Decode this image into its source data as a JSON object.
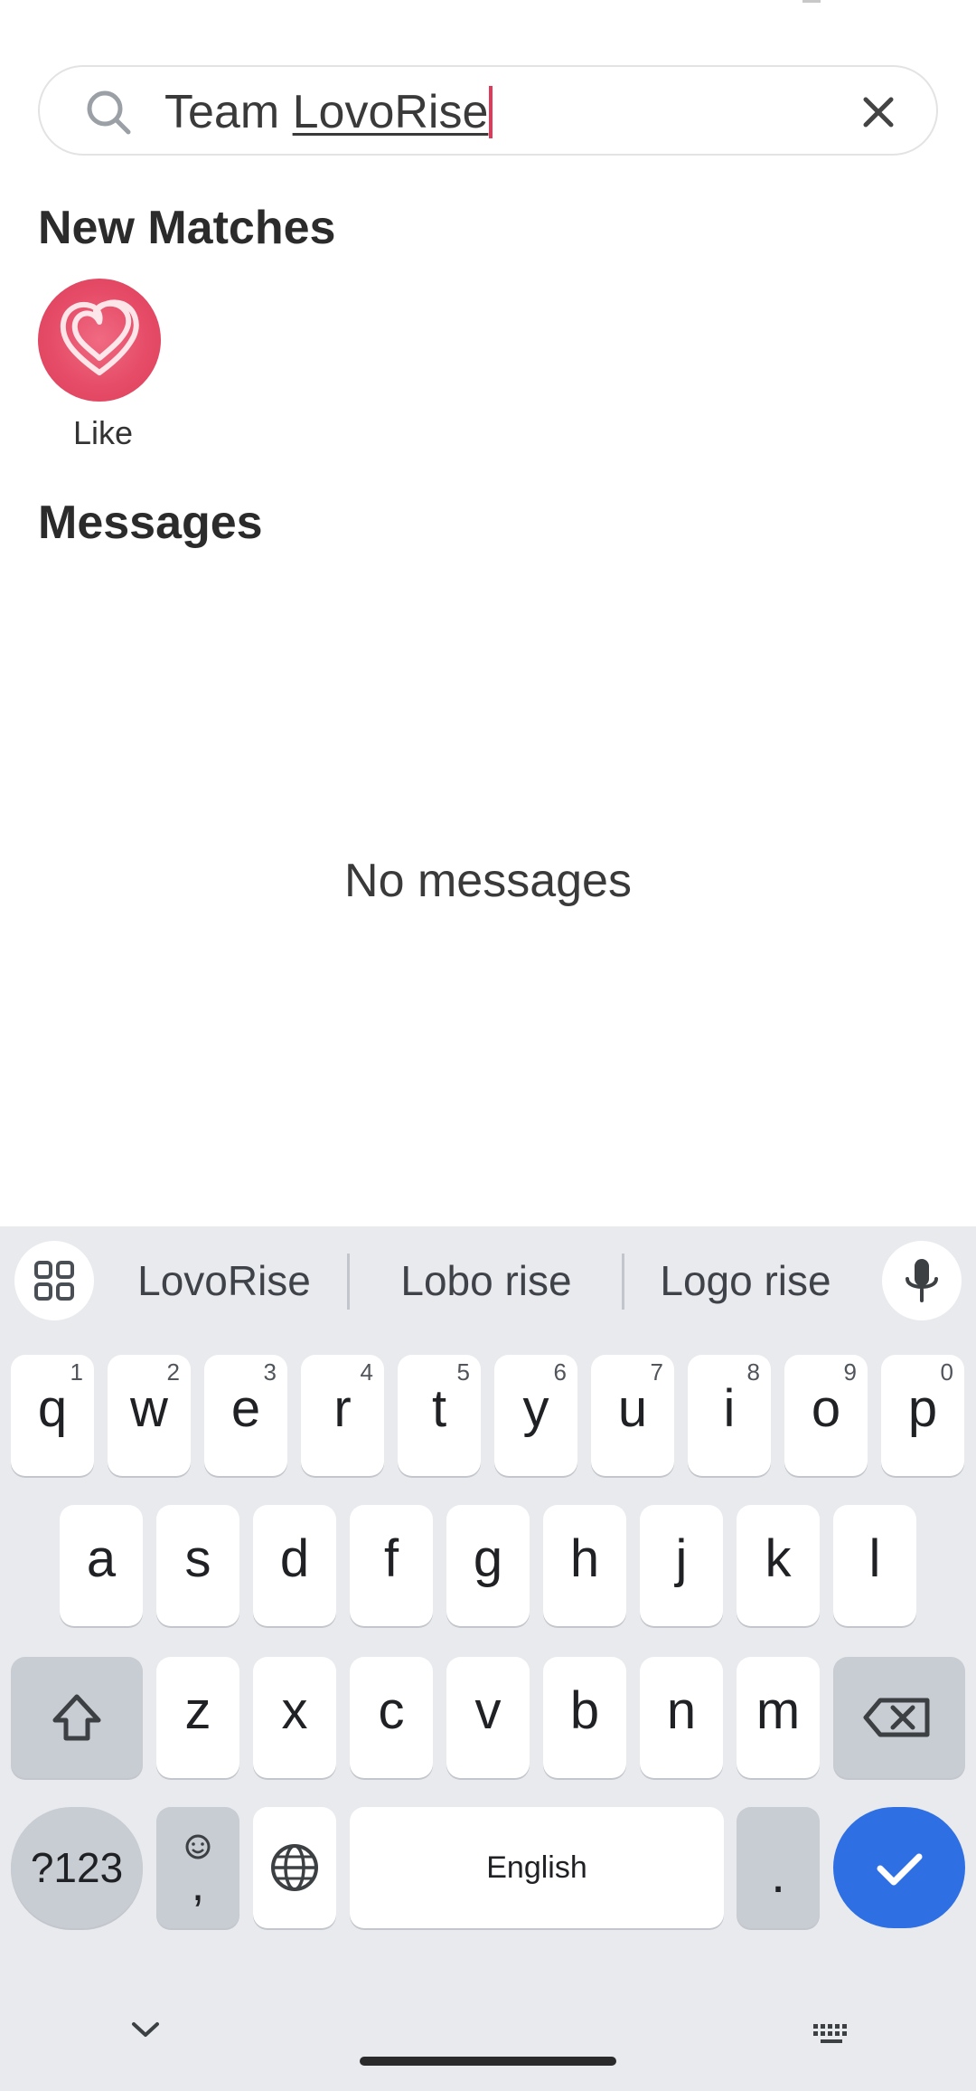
{
  "search": {
    "prefix": "Team ",
    "composing": "LovoRise"
  },
  "sections": {
    "new_matches_title": "New Matches",
    "messages_title": "Messages"
  },
  "new_matches": [
    {
      "label": "Like",
      "icon": "heart-logo-icon"
    }
  ],
  "messages": {
    "empty_text": "No messages"
  },
  "keyboard": {
    "suggestions": [
      "LovoRise",
      "Lobo rise",
      "Logo rise"
    ],
    "row1": [
      {
        "key": "q",
        "hint": "1"
      },
      {
        "key": "w",
        "hint": "2"
      },
      {
        "key": "e",
        "hint": "3"
      },
      {
        "key": "r",
        "hint": "4"
      },
      {
        "key": "t",
        "hint": "5"
      },
      {
        "key": "y",
        "hint": "6"
      },
      {
        "key": "u",
        "hint": "7"
      },
      {
        "key": "i",
        "hint": "8"
      },
      {
        "key": "o",
        "hint": "9"
      },
      {
        "key": "p",
        "hint": "0"
      }
    ],
    "row2": [
      "a",
      "s",
      "d",
      "f",
      "g",
      "h",
      "j",
      "k",
      "l"
    ],
    "row3": [
      "z",
      "x",
      "c",
      "v",
      "b",
      "n",
      "m"
    ],
    "symbols_label": "?123",
    "comma_label": ",",
    "space_label": "English",
    "period_label": ".",
    "accent_color": "#2f6fe4"
  }
}
